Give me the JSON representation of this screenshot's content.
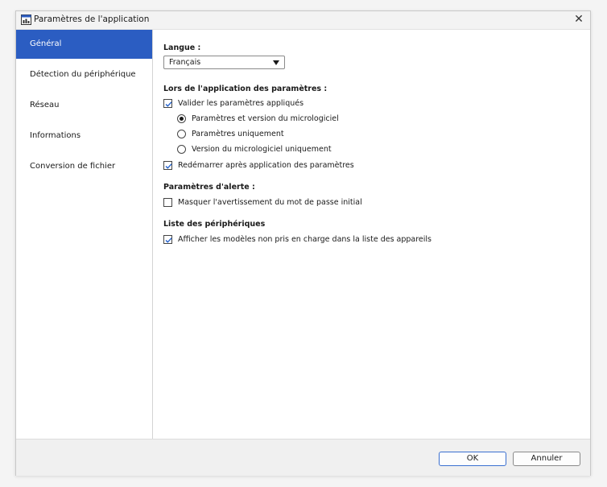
{
  "window": {
    "title": "Paramètres de l'application",
    "close_label": "✕"
  },
  "sidebar": {
    "items": [
      {
        "label": "Général",
        "active": true
      },
      {
        "label": "Détection du périphérique",
        "active": false
      },
      {
        "label": "Réseau",
        "active": false
      },
      {
        "label": "Informations",
        "active": false
      },
      {
        "label": "Conversion de fichier",
        "active": false
      }
    ]
  },
  "general": {
    "language": {
      "label": "Langue  :",
      "selected": "Français"
    },
    "apply_settings": {
      "label": "Lors de l'application des paramètres :",
      "validate": {
        "label": "Valider les paramètres appliqués",
        "checked": true
      },
      "radio_options": [
        {
          "label": "Paramètres et version du micrologiciel",
          "selected": true
        },
        {
          "label": "Paramètres uniquement",
          "selected": false
        },
        {
          "label": "Version du micrologiciel uniquement",
          "selected": false
        }
      ],
      "restart": {
        "label": "Redémarrer après application des paramètres",
        "checked": true
      }
    },
    "alert_settings": {
      "label": "Paramètres d'alerte :",
      "hide_password_warning": {
        "label": "Masquer l'avertissement du mot de passe initial",
        "checked": false
      }
    },
    "device_list": {
      "label": "Liste des périphériques",
      "show_unsupported": {
        "label": "Afficher les modèles non pris en charge dans la liste des appareils",
        "checked": true
      }
    }
  },
  "footer": {
    "ok_label": "OK",
    "cancel_label": "Annuler"
  },
  "colors": {
    "accent": "#2b5dc2",
    "check_color": "#1f5fcc"
  },
  "icons": {
    "title": "app-settings-icon",
    "close": "close-icon",
    "dropdown": "chevron-down-icon",
    "check": "check-icon"
  }
}
